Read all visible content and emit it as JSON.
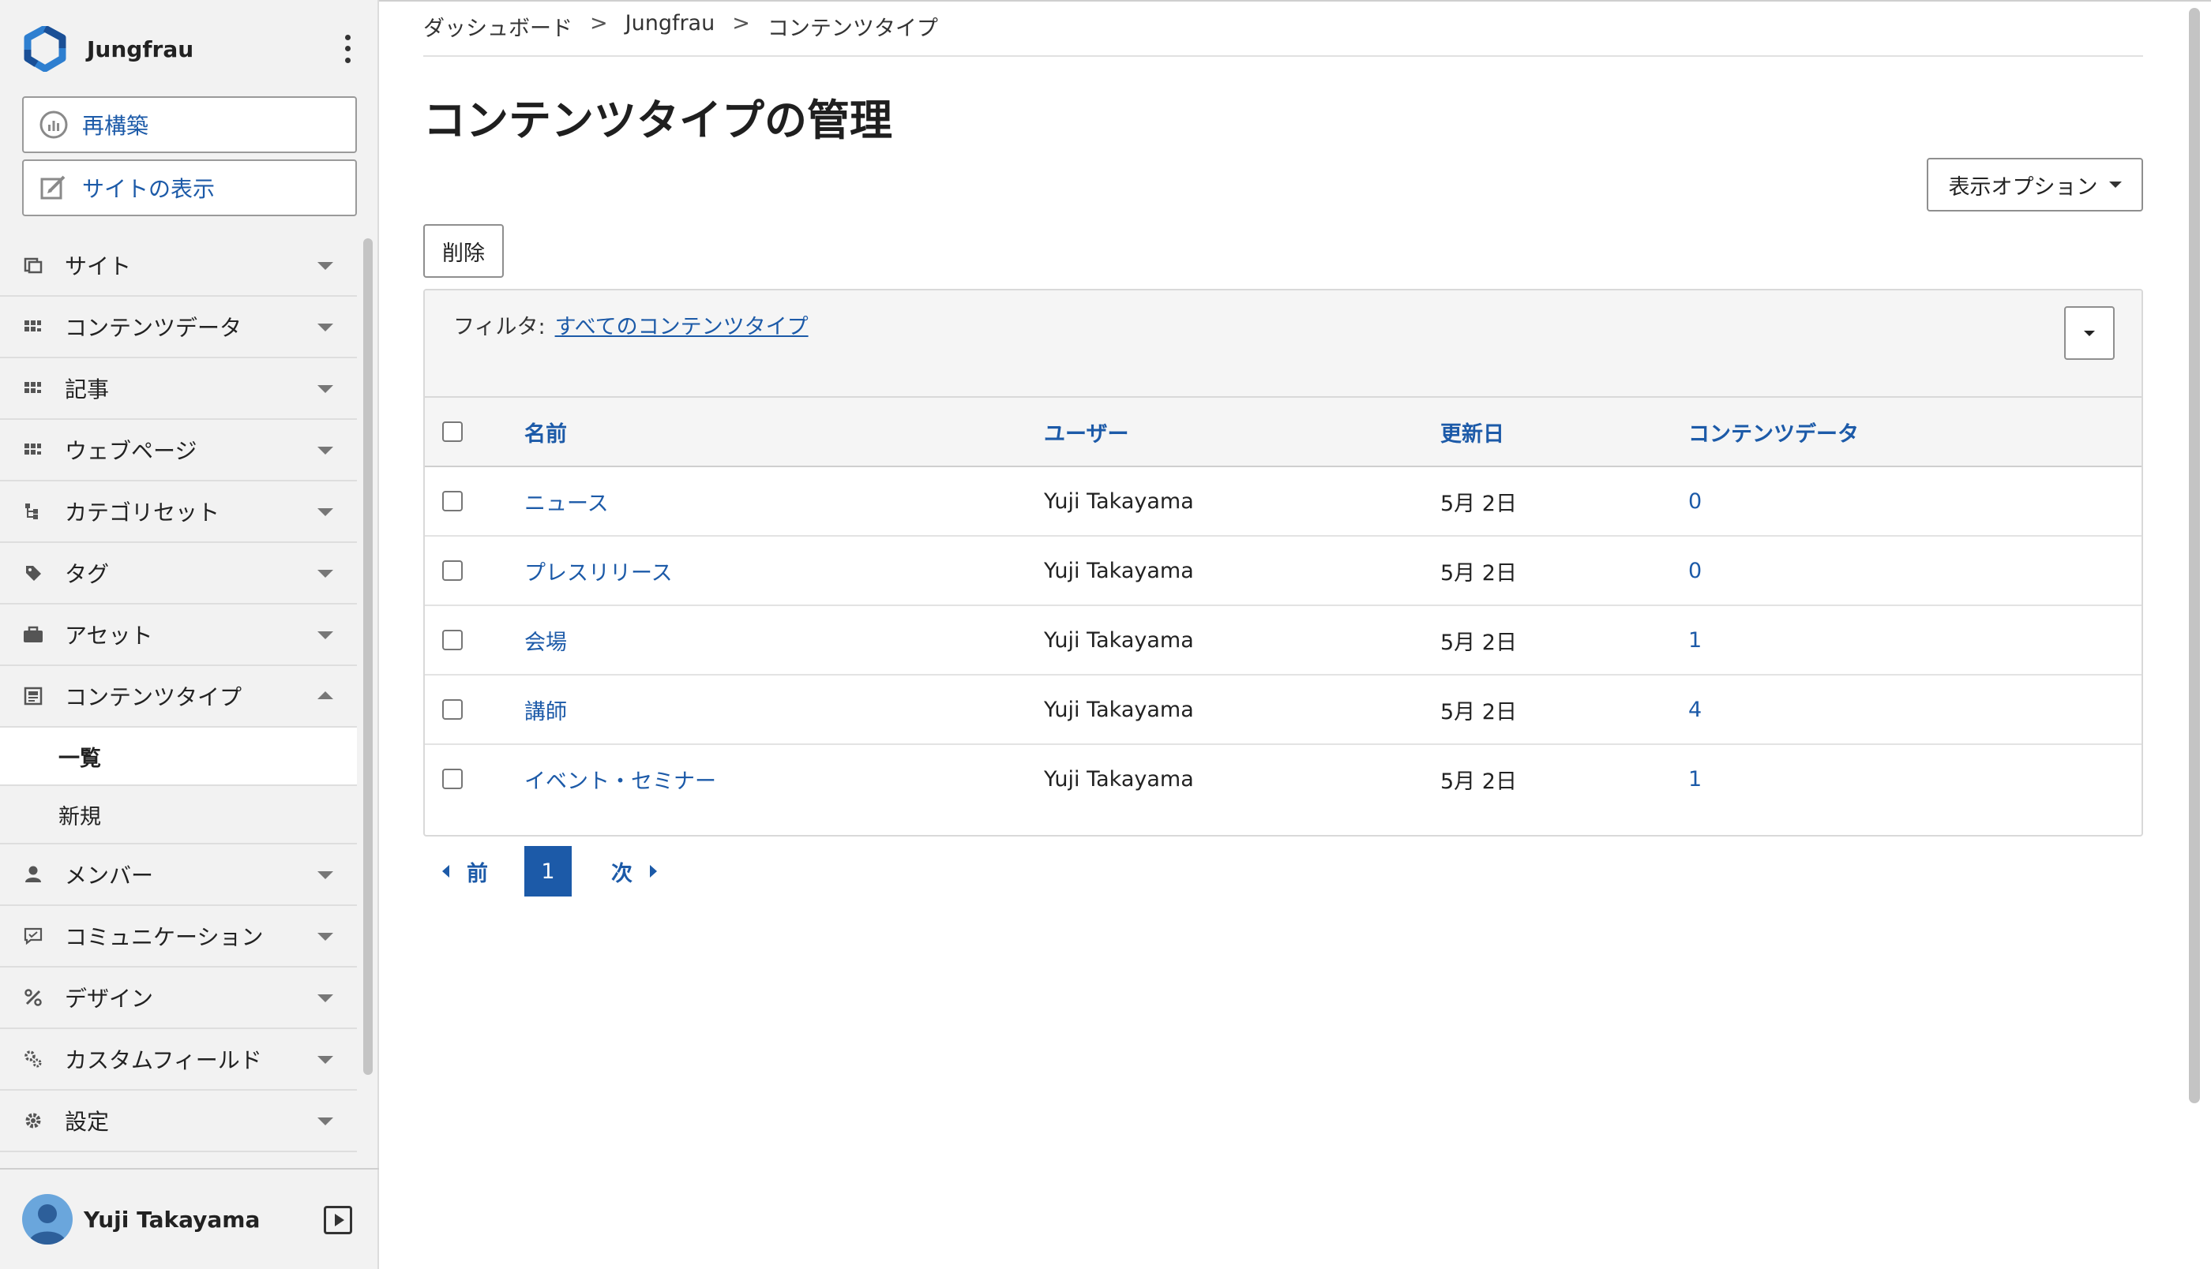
{
  "app": {
    "name": "Jungfrau"
  },
  "sidebar": {
    "buttons": {
      "rebuild": "再構築",
      "view_site": "サイトの表示"
    },
    "items": [
      {
        "label": "サイト",
        "icon": "site-icon"
      },
      {
        "label": "コンテンツデータ",
        "icon": "grid-icon"
      },
      {
        "label": "記事",
        "icon": "grid-icon"
      },
      {
        "label": "ウェブページ",
        "icon": "grid-icon"
      },
      {
        "label": "カテゴリセット",
        "icon": "tree-icon"
      },
      {
        "label": "タグ",
        "icon": "tag-icon"
      },
      {
        "label": "アセット",
        "icon": "briefcase-icon"
      },
      {
        "label": "コンテンツタイプ",
        "icon": "content-type-icon"
      }
    ],
    "sub_items": [
      {
        "label": "一覧",
        "active": true
      },
      {
        "label": "新規",
        "active": false
      }
    ],
    "items_after": [
      {
        "label": "メンバー",
        "icon": "user-icon"
      },
      {
        "label": "コミュニケーション",
        "icon": "comment-icon"
      },
      {
        "label": "デザイン",
        "icon": "design-icon"
      },
      {
        "label": "カスタムフィールド",
        "icon": "gears-icon"
      },
      {
        "label": "設定",
        "icon": "gear-icon"
      }
    ],
    "user": {
      "name": "Yuji Takayama"
    }
  },
  "breadcrumb": {
    "items": [
      "ダッシュボード",
      "Jungfrau",
      "コンテンツタイプ"
    ],
    "separator": ">"
  },
  "page": {
    "title": "コンテンツタイプの管理"
  },
  "toolbar": {
    "display_options": "表示オプション",
    "delete": "削除"
  },
  "filter": {
    "label": "フィルタ:",
    "value": "すべてのコンテンツタイプ"
  },
  "table": {
    "headers": {
      "name": "名前",
      "user": "ユーザー",
      "modified": "更新日",
      "content_data": "コンテンツデータ"
    },
    "rows": [
      {
        "name": "ニュース",
        "user": "Yuji Takayama",
        "modified": "5月 2日",
        "content_data": "0"
      },
      {
        "name": "プレスリリース",
        "user": "Yuji Takayama",
        "modified": "5月 2日",
        "content_data": "0"
      },
      {
        "name": "会場",
        "user": "Yuji Takayama",
        "modified": "5月 2日",
        "content_data": "1"
      },
      {
        "name": "講師",
        "user": "Yuji Takayama",
        "modified": "5月 2日",
        "content_data": "4"
      },
      {
        "name": "イベント・セミナー",
        "user": "Yuji Takayama",
        "modified": "5月 2日",
        "content_data": "1"
      }
    ]
  },
  "pagination": {
    "prev": "前",
    "current": "1",
    "next": "次"
  },
  "colors": {
    "accent": "#1c5aa8",
    "sidebar_bg": "#f2f2f2"
  }
}
